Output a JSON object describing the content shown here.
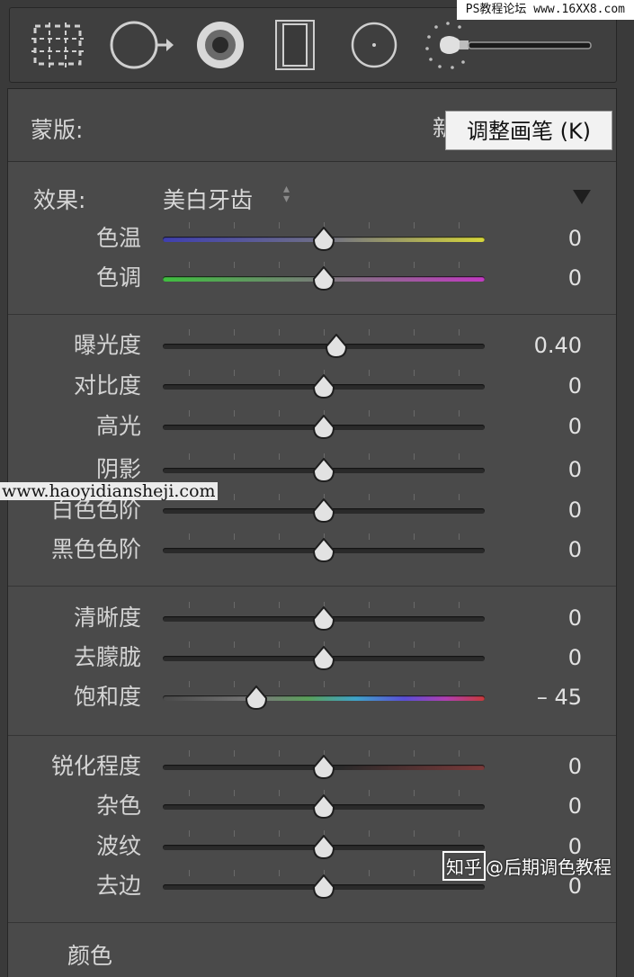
{
  "watermarks": {
    "top": "PS教程论坛 www.16XX8.com",
    "middle": "www.haoyidiansheji.com",
    "bottom_frame": "知乎",
    "bottom_text": "@后期调色教程"
  },
  "toolbar": {
    "tools": [
      {
        "name": "crop-overlay-icon"
      },
      {
        "name": "spot-removal-icon"
      },
      {
        "name": "red-eye-icon"
      },
      {
        "name": "graduated-filter-icon"
      },
      {
        "name": "radial-filter-icon"
      },
      {
        "name": "adjustment-brush-icon"
      }
    ]
  },
  "mask": {
    "label": "蒙版:",
    "hidden_text": "新",
    "tooltip": "调整画笔 (K)"
  },
  "effect": {
    "label": "效果:",
    "value": "美白牙齿"
  },
  "sliders": [
    {
      "label": "色温",
      "value": "0",
      "pos": 0.5,
      "track": "temp"
    },
    {
      "label": "色调",
      "value": "0",
      "pos": 0.5,
      "track": "tint"
    },
    {
      "label": "曝光度",
      "value": "0.40",
      "pos": 0.54,
      "track": "plain"
    },
    {
      "label": "对比度",
      "value": "0",
      "pos": 0.5,
      "track": "plain"
    },
    {
      "label": "高光",
      "value": "0",
      "pos": 0.5,
      "track": "plain"
    },
    {
      "label": "阴影",
      "value": "0",
      "pos": 0.5,
      "track": "plain"
    },
    {
      "label": "白色色阶",
      "value": "0",
      "pos": 0.5,
      "track": "plain"
    },
    {
      "label": "黑色色阶",
      "value": "0",
      "pos": 0.5,
      "track": "plain"
    },
    {
      "label": "清晰度",
      "value": "0",
      "pos": 0.5,
      "track": "plain"
    },
    {
      "label": "去朦胧",
      "value": "0",
      "pos": 0.5,
      "track": "plain"
    },
    {
      "label": "饱和度",
      "value": "– 45",
      "pos": 0.29,
      "track": "saturation"
    },
    {
      "label": "锐化程度",
      "value": "0",
      "pos": 0.5,
      "track": "sharpen"
    },
    {
      "label": "杂色",
      "value": "0",
      "pos": 0.5,
      "track": "plain"
    },
    {
      "label": "波纹",
      "value": "0",
      "pos": 0.5,
      "track": "plain"
    },
    {
      "label": "去边",
      "value": "0",
      "pos": 0.5,
      "track": "plain"
    }
  ],
  "color": {
    "label": "颜色"
  },
  "colors": {
    "panel_bg": "#4a4a4a",
    "temp_start": "#3f3fb0",
    "temp_end": "#d6d63a",
    "tint_start": "#3fbf3f",
    "tint_end": "#c23ac2"
  }
}
